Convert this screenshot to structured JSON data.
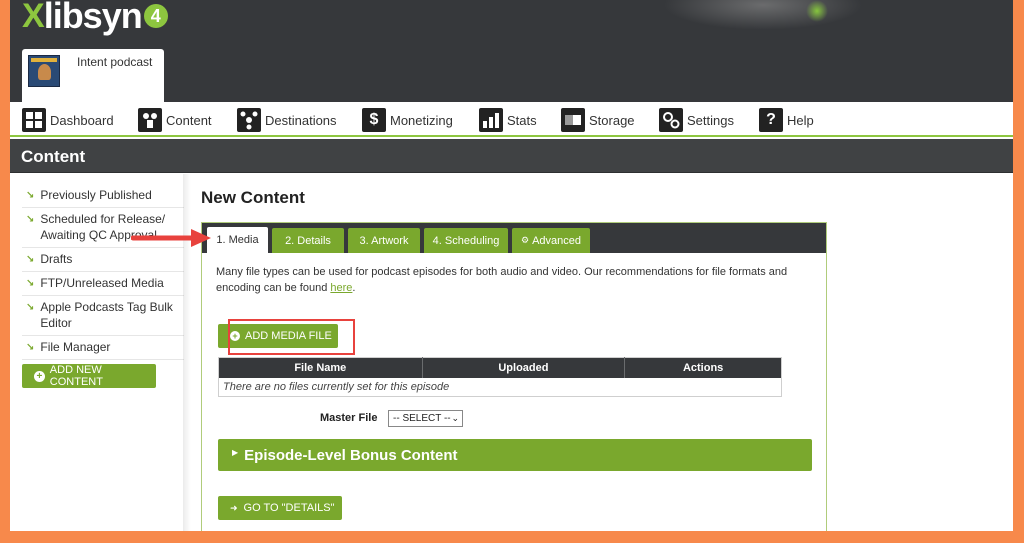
{
  "app": {
    "logo_mark": "X",
    "logo_text": "libsyn",
    "logo_version": "4"
  },
  "podcast": {
    "name": "Intent podcast"
  },
  "nav": {
    "items": [
      {
        "label": "Dashboard",
        "icon": "dashboard-icon"
      },
      {
        "label": "Content",
        "icon": "content-icon"
      },
      {
        "label": "Destinations",
        "icon": "destinations-icon"
      },
      {
        "label": "Monetizing",
        "icon": "dollar-icon"
      },
      {
        "label": "Stats",
        "icon": "stats-icon"
      },
      {
        "label": "Storage",
        "icon": "storage-icon"
      },
      {
        "label": "Settings",
        "icon": "settings-icon"
      },
      {
        "label": "Help",
        "icon": "help-icon"
      }
    ]
  },
  "section": {
    "title": "Content"
  },
  "sidebar": {
    "items": [
      {
        "label": "Previously Published"
      },
      {
        "label": "Scheduled for Release/ Awaiting QC Approval"
      },
      {
        "label": "Drafts"
      },
      {
        "label": "FTP/Unreleased Media"
      },
      {
        "label": "Apple Podcasts Tag Bulk Editor"
      },
      {
        "label": "File Manager"
      }
    ],
    "add_new_label": "ADD NEW CONTENT"
  },
  "main": {
    "title": "New Content",
    "tabs": [
      {
        "label": "1. Media",
        "active": true
      },
      {
        "label": "2. Details",
        "active": false
      },
      {
        "label": "3. Artwork",
        "active": false
      },
      {
        "label": "4. Scheduling",
        "active": false
      },
      {
        "label": "Advanced",
        "active": false
      }
    ],
    "description_text": "Many file types can be used for podcast episodes for both audio and video. Our recommendations for file formats and encoding can be found ",
    "description_link": "here",
    "description_end": ".",
    "add_media_label": "ADD MEDIA FILE",
    "table": {
      "headers": [
        "File Name",
        "Uploaded",
        "Actions"
      ],
      "empty_message": "There are no files currently set for this episode"
    },
    "master_file_label": "Master File",
    "master_file_selected": "-- SELECT --",
    "bonus_label": "Episode-Level Bonus Content",
    "go_details_label": "GO TO \"DETAILS\""
  },
  "colors": {
    "accent_green": "#7aa82d",
    "header_dark": "#36383b",
    "annotation_red": "#e8423d",
    "frame_orange": "#f7894b"
  }
}
